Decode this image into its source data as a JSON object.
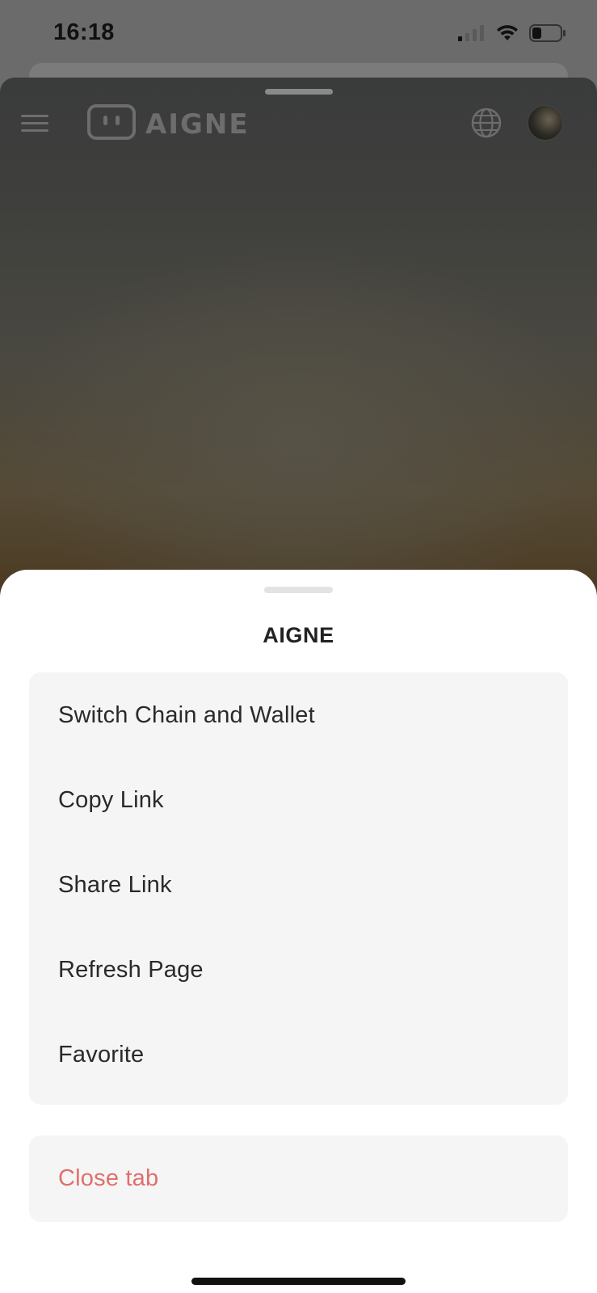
{
  "status_bar": {
    "time": "16:18",
    "icons": [
      "cellular-signal-icon",
      "wifi-icon",
      "battery-icon"
    ]
  },
  "web_header": {
    "logo_text": "AIGNE",
    "icons": [
      "menu-icon",
      "globe-icon",
      "avatar"
    ]
  },
  "sheet": {
    "title": "AIGNE",
    "items": [
      {
        "label": "Switch Chain and Wallet"
      },
      {
        "label": "Copy Link"
      },
      {
        "label": "Share Link"
      },
      {
        "label": "Refresh Page"
      },
      {
        "label": "Favorite"
      }
    ],
    "close_label": "Close tab"
  },
  "colors": {
    "overlay_background": "#6b6b6b",
    "sheet_background": "#ffffff",
    "menu_group_background": "#f5f5f5",
    "danger_text": "#e06f6c"
  }
}
